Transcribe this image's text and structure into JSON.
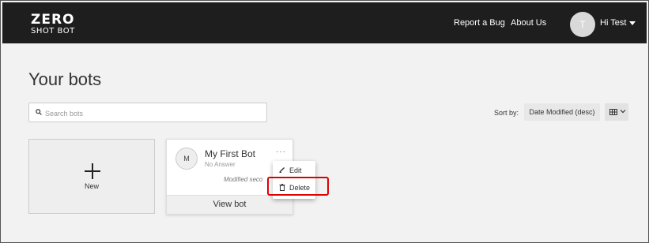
{
  "header": {
    "logo_line1": "ZERO",
    "logo_line2": "SHOT BOT",
    "nav": [
      {
        "label": "Report a Bug"
      },
      {
        "label": "About Us"
      }
    ],
    "user_initial": "T",
    "user_greeting": "Hi Test"
  },
  "main": {
    "title": "Your bots",
    "search_placeholder": "Search bots",
    "sort_label": "Sort by:",
    "sort_value": "Date Modified (desc)"
  },
  "new_card": {
    "label": "New"
  },
  "bot_card": {
    "initial": "M",
    "name": "My First Bot",
    "subtitle": "No Answer",
    "modified": "Modified seco",
    "more": "···",
    "view_label": "View bot"
  },
  "context_menu": {
    "items": [
      {
        "label": "Edit",
        "icon": "pencil-icon"
      },
      {
        "label": "Delete",
        "icon": "trash-icon"
      }
    ]
  },
  "colors": {
    "header_bg": "#1e1e1e",
    "highlight": "#e00000"
  }
}
